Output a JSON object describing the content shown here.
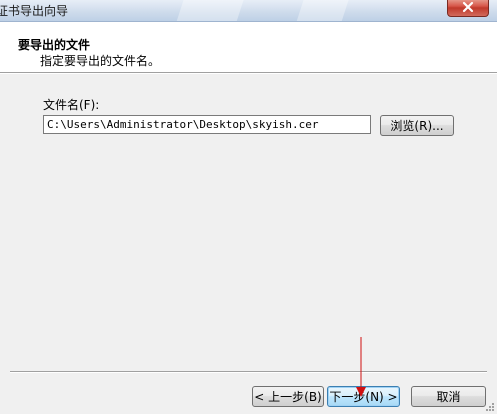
{
  "window": {
    "title": "证书导出向导"
  },
  "header": {
    "title": "要导出的文件",
    "subtitle": "指定要导出的文件名。"
  },
  "form": {
    "file_label": "文件名(F):",
    "file_value": "C:\\Users\\Administrator\\Desktop\\skyish.cer",
    "browse_label": "浏览(R)..."
  },
  "footer": {
    "back_label": "< 上一步(B)",
    "next_label": "下一步(N) >",
    "cancel_label": "取消"
  },
  "colors": {
    "annotation_arrow": "#d01010",
    "close_button": "#c0392b",
    "default_button_border": "#3c7fb1"
  }
}
